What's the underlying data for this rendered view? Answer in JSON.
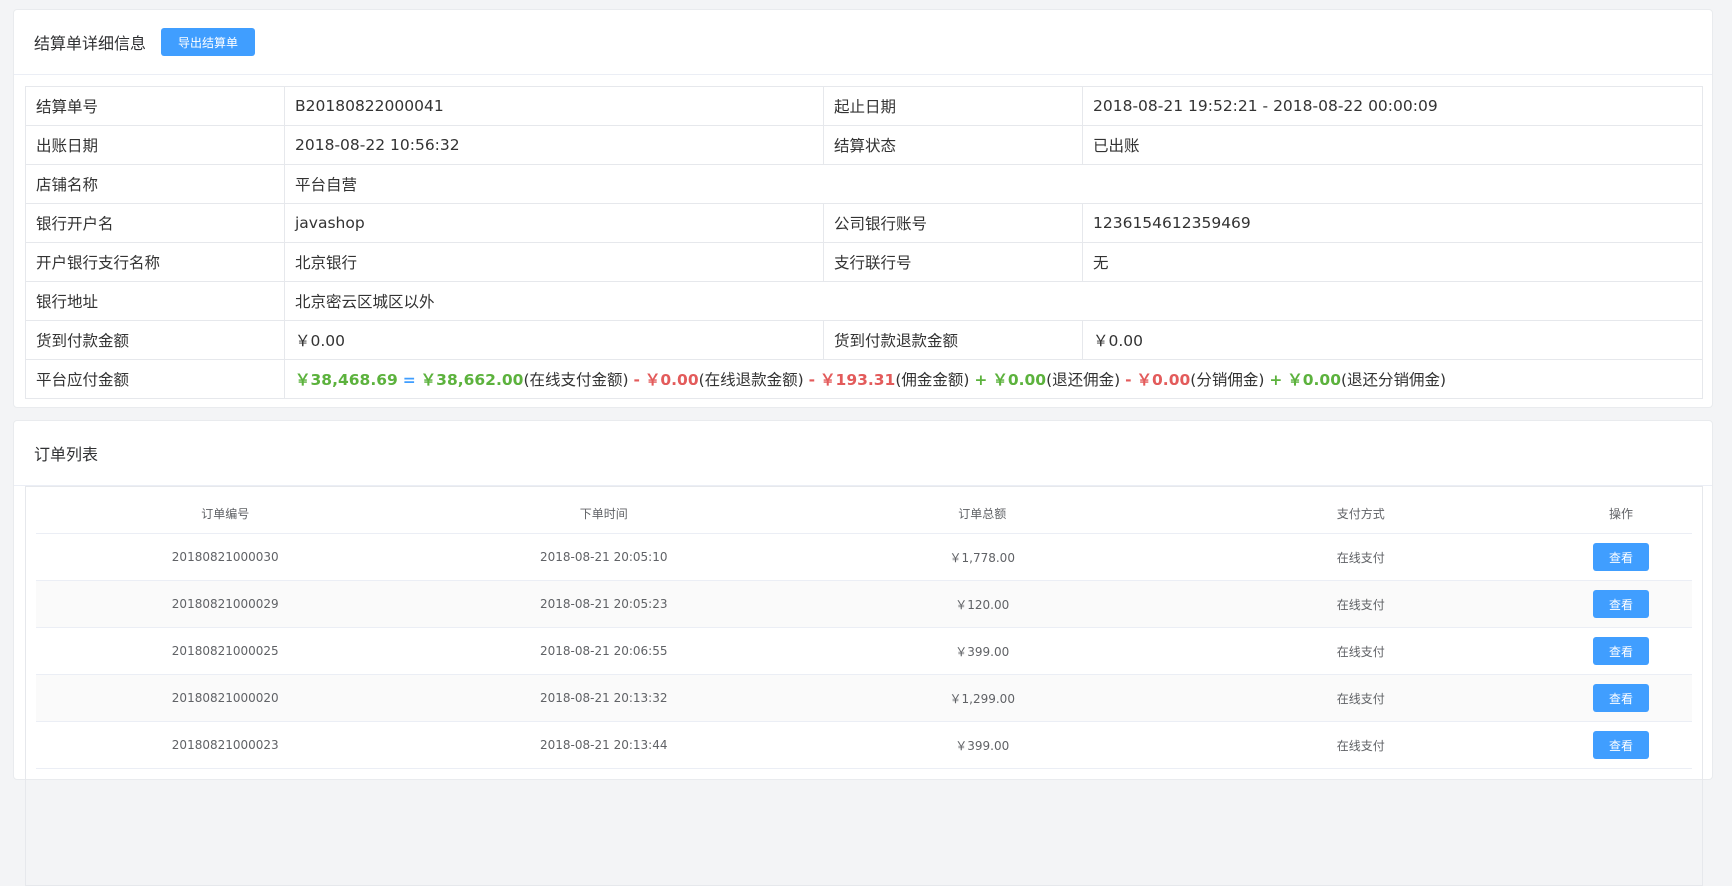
{
  "settlement": {
    "title": "结算单详细信息",
    "export_button": "导出结算单",
    "rows": {
      "bill_no_label": "结算单号",
      "bill_no": "B20180822000041",
      "period_label": "起止日期",
      "period": "2018-08-21 19:52:21 - 2018-08-22 00:00:09",
      "bill_date_label": "出账日期",
      "bill_date": "2018-08-22 10:56:32",
      "status_label": "结算状态",
      "status": "已出账",
      "shop_label": "店铺名称",
      "shop": "平台自营",
      "bank_account_name_label": "银行开户名",
      "bank_account_name": "javashop",
      "company_account_label": "公司银行账号",
      "company_account": "1236154612359469",
      "branch_label": "开户银行支行名称",
      "branch": "北京银行",
      "branch_code_label": "支行联行号",
      "branch_code": "无",
      "bank_address_label": "银行地址",
      "bank_address": "北京密云区城区以外",
      "cod_amount_label": "货到付款金额",
      "cod_amount": "￥0.00",
      "cod_refund_label": "货到付款退款金额",
      "cod_refund": "￥0.00",
      "payable_label": "平台应付金额"
    },
    "formula": {
      "total": "￥38,468.69",
      "eq": "=",
      "online_pay": "￥38,662.00",
      "online_pay_label": "(在线支付金额)",
      "minus1": "-",
      "online_refund": "￥0.00",
      "online_refund_label": "(在线退款金额)",
      "minus2": "-",
      "commission": "￥193.31",
      "commission_label": "(佣金金额)",
      "plus1": "+",
      "return_commission": "￥0.00",
      "return_commission_label": "(退还佣金)",
      "minus3": "-",
      "dist_commission": "￥0.00",
      "dist_commission_label": "(分销佣金)",
      "plus2": "+",
      "return_dist": "￥0.00",
      "return_dist_label": "(退还分销佣金)"
    }
  },
  "orders": {
    "title": "订单列表",
    "columns": [
      "订单编号",
      "下单时间",
      "订单总额",
      "支付方式",
      "操作"
    ],
    "view_label": "查看",
    "rows": [
      {
        "sn": "20180821000030",
        "time": "2018-08-21 20:05:10",
        "amount": "￥1,778.00",
        "pay": "在线支付"
      },
      {
        "sn": "20180821000029",
        "time": "2018-08-21 20:05:23",
        "amount": "￥120.00",
        "pay": "在线支付"
      },
      {
        "sn": "20180821000025",
        "time": "2018-08-21 20:06:55",
        "amount": "￥399.00",
        "pay": "在线支付"
      },
      {
        "sn": "20180821000020",
        "time": "2018-08-21 20:13:32",
        "amount": "￥1,299.00",
        "pay": "在线支付"
      },
      {
        "sn": "20180821000023",
        "time": "2018-08-21 20:13:44",
        "amount": "￥399.00",
        "pay": "在线支付"
      }
    ]
  },
  "colors": {
    "primary": "#409eff",
    "positive": "#5cb23d",
    "negative": "#e35b5b"
  }
}
